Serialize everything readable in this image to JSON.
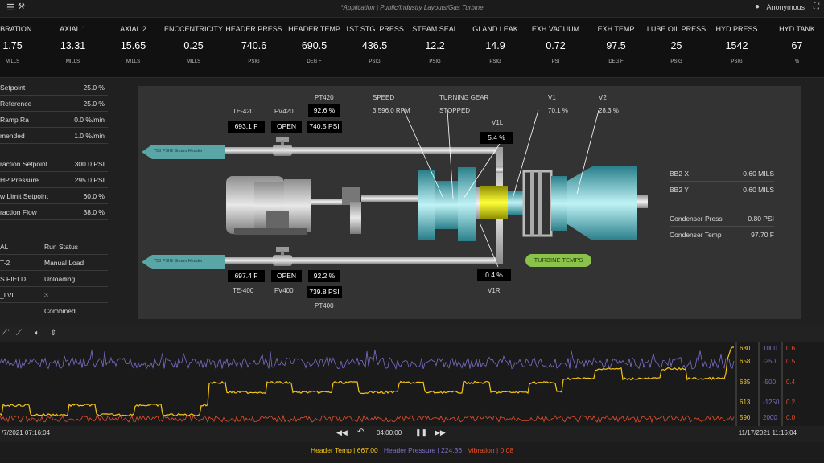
{
  "header": {
    "path": "*Application | Public/Industry Layouts/Gas Turbine",
    "user": "Anonymous"
  },
  "metrics": [
    {
      "label": "VIBRATION",
      "value": "1.75",
      "unit": "MILLS"
    },
    {
      "label": "AXIAL 1",
      "value": "13.31",
      "unit": "MILLS"
    },
    {
      "label": "AXIAL 2",
      "value": "15.65",
      "unit": "MILLS"
    },
    {
      "label": "ENCCENTRICITY",
      "value": "0.25",
      "unit": "MILLS"
    },
    {
      "label": "HEADER PRESS",
      "value": "740.6",
      "unit": "PSIG"
    },
    {
      "label": "HEADER TEMP",
      "value": "690.5",
      "unit": "DEG F"
    },
    {
      "label": "1ST STG. PRESS",
      "value": "436.5",
      "unit": "PSIG"
    },
    {
      "label": "STEAM SEAL",
      "value": "12.2",
      "unit": "PSIG"
    },
    {
      "label": "GLAND LEAK",
      "value": "14.9",
      "unit": "PSIG"
    },
    {
      "label": "EXH VACUUM",
      "value": "0.72",
      "unit": "PSI"
    },
    {
      "label": "EXH TEMP",
      "value": "97.5",
      "unit": "DEG F"
    },
    {
      "label": "LUBE OIL PRESS",
      "value": "25",
      "unit": "PSIG"
    },
    {
      "label": "HYD PRESS",
      "value": "1542",
      "unit": "PSIG"
    },
    {
      "label": "HYD TANK",
      "value": "67",
      "unit": "%"
    }
  ],
  "left_rows": [
    {
      "k": "Setpoint",
      "v": "25.0 %"
    },
    {
      "k": "Reference",
      "v": "25.0 %"
    },
    {
      "k": "Ramp Ra",
      "v": "0.0 %/min"
    },
    {
      "k": "mended",
      "v": "1.0 %/min"
    },
    {
      "k": "raction Setpoint",
      "v": "300.0 PSI"
    },
    {
      "k": " HP Pressure",
      "v": "295.0 PSI"
    },
    {
      "k": "w Limit Setpoint",
      "v": "60.0 %"
    },
    {
      "k": "raction Flow",
      "v": "38.0 %"
    }
  ],
  "left_rows2": [
    {
      "k": "AL",
      "v": "Run Status"
    },
    {
      "k": "T-2",
      "v": "Manual Load"
    },
    {
      "k": "S FIELD",
      "v": "Unloading"
    },
    {
      "k": "_LVL",
      "v": "3"
    },
    {
      "k": "",
      "v": "Combined"
    }
  ],
  "diagram": {
    "steam_header_top": "750 PSIG Steam Header",
    "steam_header_bottom": "750 PSIG Steam Header",
    "te420_label": "TE-420",
    "te420_value": "693.1 F",
    "fv420_label": "FV420",
    "fv420_value": "OPEN",
    "pt420_label": "PT420",
    "pt420_pct": "92.6 %",
    "pt420_psi": "740.5 PSI",
    "te400_label": "TE-400",
    "te400_value": "697.4 F",
    "fv400_label": "FV400",
    "fv400_value": "OPEN",
    "pt400_label": "PT400",
    "pt400_pct": "92.2 %",
    "pt400_psi": "739.8 PSI",
    "speed_label": "SPEED",
    "speed_value": "3,596.0 RPM",
    "turning_label": "TURNING GEAR",
    "turning_value": "STOPPED",
    "v1l_label": "V1L",
    "v1l_value": "5.4 %",
    "v1_label": "V1",
    "v1_value": "70.1 %",
    "v2_label": "V2",
    "v2_value": "28.3 %",
    "v1r_label": "V1R",
    "v1r_value": "0.4 %",
    "turbine_temps": "TURBINE TEMPS",
    "right_rows": [
      {
        "k": "BB2 X",
        "v": "0.60 MILS"
      },
      {
        "k": "BB2 Y",
        "v": "0.60 MILS"
      },
      {
        "k": "Condenser Press",
        "v": "0.80 PSI"
      },
      {
        "k": "Condenser Temp",
        "v": "97.70 F"
      }
    ]
  },
  "colors": {
    "header_temp": "#f5c518",
    "header_pressure": "#7b6fc9",
    "vibration": "#e8502a",
    "accent_green": "#8bc34a"
  },
  "chart_axes": {
    "yellow": [
      "680",
      "658",
      "635",
      "613",
      "590"
    ],
    "purple": [
      "1000",
      "-250",
      "-500",
      "-1250",
      "2000"
    ],
    "red": [
      "0.6",
      "0.5",
      "0.4",
      "0.2",
      "0.0"
    ]
  },
  "timeline": {
    "start": "/7/2021  07:16:04",
    "center": "04:00:00",
    "end": "11/17/2021  11:16:04"
  },
  "legend": {
    "header_temp": "Header Temp | 667.00",
    "header_pressure": "Header Pressure | 224.36",
    "vibration": "Vibration | 0.08"
  },
  "toolbar_icons": [
    "line-add-icon",
    "line-remove-icon",
    "mouse-icon",
    "cursor-icon"
  ]
}
